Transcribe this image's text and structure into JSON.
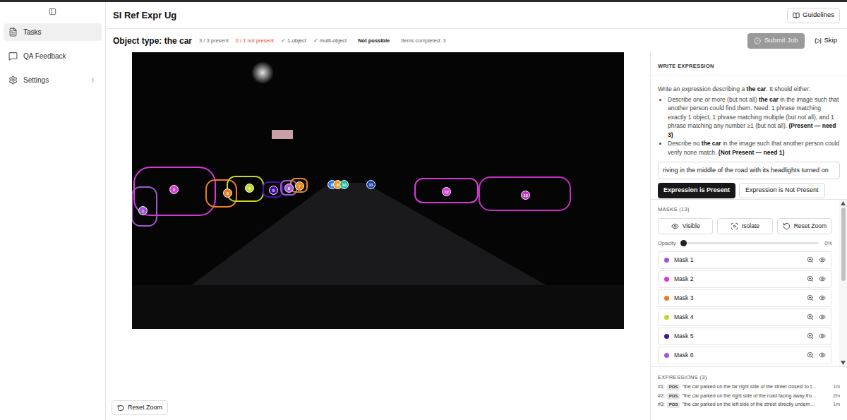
{
  "app": {
    "title": "Sl Ref Expr Ug"
  },
  "sidebar": {
    "items": [
      {
        "label": "Tasks",
        "selected": true,
        "kind": "tasks"
      },
      {
        "label": "QA Feedback",
        "selected": false,
        "kind": "feedback"
      },
      {
        "label": "Settings",
        "selected": false,
        "kind": "settings"
      }
    ]
  },
  "header": {
    "guidelines": "Guidelines"
  },
  "status": {
    "object_type": "Object type: the car",
    "present": "3 / 3 present",
    "not_present": "0 / 1 not present",
    "checks": [
      {
        "mark": "✓",
        "label": "1-object",
        "checked": true
      },
      {
        "mark": "✓",
        "label": "multi-object",
        "checked": true
      }
    ],
    "not_possible": "Not possible",
    "items_completed": "Items completed: 3"
  },
  "actions": {
    "submit": {
      "label": "Submit Job",
      "disabled": true
    },
    "skip": "Skip"
  },
  "canvas": {
    "masks": [
      {
        "number": "1",
        "color": "#9b59d0"
      },
      {
        "number": "2",
        "color": "#d63ad6"
      },
      {
        "number": "3",
        "color": "#e67e22"
      },
      {
        "number": "4",
        "color": "#c5d62e"
      },
      {
        "number": "5",
        "color": "#4b0fa8"
      },
      {
        "number": "6",
        "color": "#a259d9"
      },
      {
        "number": "7",
        "color": "#e8891c"
      },
      {
        "number": "8",
        "color": "#3a7be0"
      },
      {
        "number": "9",
        "color": "#f0a020"
      },
      {
        "number": "10",
        "color": "#1abc9c"
      },
      {
        "number": "11",
        "color": "#1a3fa8"
      },
      {
        "number": "12",
        "color": "#d63ad6"
      },
      {
        "number": "13",
        "color": "#c530c5"
      }
    ],
    "reset_zoom": "Reset Zoom"
  },
  "panel": {
    "heading": "WRITE EXPRESSION",
    "intro": [
      {
        "text": "Write an expression describing a ",
        "bold": false
      },
      {
        "text": "the car",
        "bold": true
      },
      {
        "text": ". It should either:",
        "bold": false
      }
    ],
    "bullets": [
      [
        {
          "text": "Describe one or more (but not all) ",
          "bold": false
        },
        {
          "text": "the car",
          "bold": true
        },
        {
          "text": " in the image such that another person could find them. Need: 1 phrase matching exactly 1 object, 1 phrase matching multiple (but not all), and 1 phrase matching any number ≥1 (but not all). ",
          "bold": false
        },
        {
          "text": "(Present — need 3)",
          "bold": true
        }
      ],
      [
        {
          "text": "Describe no ",
          "bold": false
        },
        {
          "text": "the car",
          "bold": true
        },
        {
          "text": " in the image such that another person could verify none match. ",
          "bold": false
        },
        {
          "text": "(Not Present — need 1)",
          "bold": true
        }
      ]
    ],
    "field_value": "riving in the middle of the road with its headlights turned on",
    "choice_buttons": [
      {
        "label": "Expression is Present",
        "kind": "primary"
      },
      {
        "label": "Expression is Not Present",
        "kind": "secondary"
      }
    ],
    "masks_heading": "MASKS (13)",
    "mask_tools": [
      {
        "label": "Visible",
        "kind": "visible"
      },
      {
        "label": "Isolate",
        "kind": "isolate"
      },
      {
        "label": "Reset Zoom",
        "kind": "reset"
      }
    ],
    "opacity": {
      "label": "Opacity",
      "level": 0,
      "reading": "0%"
    },
    "mask_list": [
      {
        "label": "Mask 1",
        "color": "#9b59d0"
      },
      {
        "label": "Mask 2",
        "color": "#d63ad6"
      },
      {
        "label": "Mask 3",
        "color": "#e67e22"
      },
      {
        "label": "Mask 4",
        "color": "#c5d62e"
      },
      {
        "label": "Mask 5",
        "color": "#4b0fa8"
      },
      {
        "label": "Mask 6",
        "color": "#a259d9"
      }
    ],
    "expressions_heading": "EXPRESSIONS (3)",
    "expressions": [
      {
        "index": "#1:",
        "tag": "POS",
        "text": "\"the car parked on the far right side of the street closest to t…",
        "time": "1m"
      },
      {
        "index": "#2:",
        "tag": "POS",
        "text": "\"the car parked on the right side of the road facing away fro…",
        "time": "2m"
      },
      {
        "index": "#3:",
        "tag": "POS",
        "text": "\"the car parked on the left side of the street directly undern…",
        "time": "1m"
      }
    ]
  }
}
